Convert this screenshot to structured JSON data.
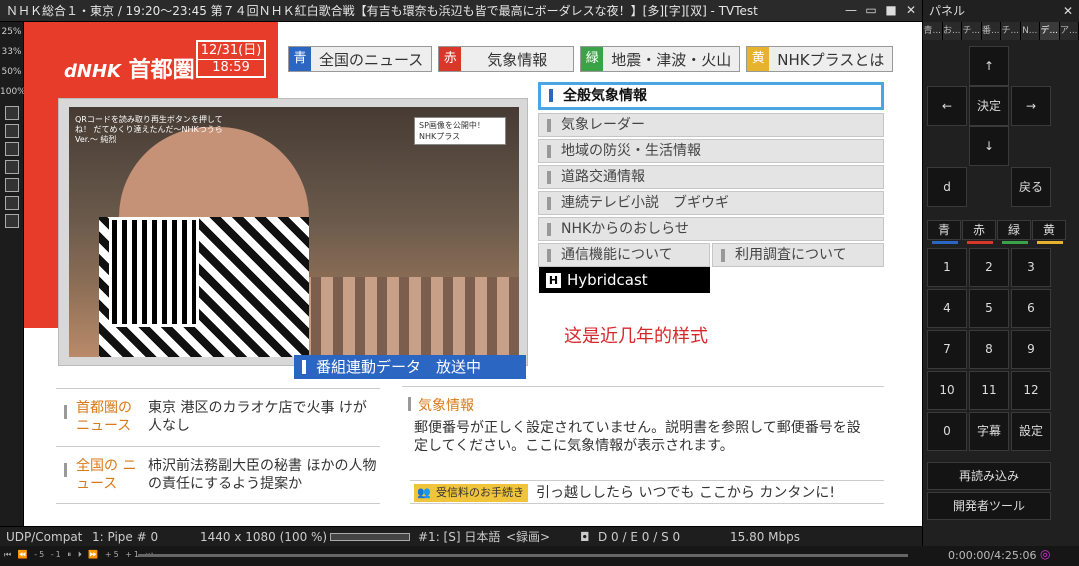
{
  "window": {
    "title": "ＮＨＫ総合１・東京 / 19:20～23:45 第７４回ＮＨＫ紅白歌合戦【有吉も環奈も浜辺も皆で最高にボーダレスな夜！】[多][字][双] - TVTest",
    "minimize": "—",
    "restore": "▭",
    "maximize": "■",
    "close": "✕"
  },
  "left_toolbar": {
    "zoom": [
      "25%",
      "33%",
      "50%",
      "100%"
    ]
  },
  "broadcast": {
    "logo_prefix": "dNHK",
    "logo_region": "首都圏",
    "date": "12/31(日)",
    "time": "18:59",
    "tabs": [
      {
        "key": "青",
        "label": "全国のニュース",
        "color": "#2b66c3"
      },
      {
        "key": "赤",
        "label": "気象情報",
        "color": "#d8382a"
      },
      {
        "key": "緑",
        "label": "地震・津波・火山",
        "color": "#3ba347"
      },
      {
        "key": "黄",
        "label": "NHKプラスとは",
        "color": "#e7b32f"
      }
    ],
    "video_caption": "QRコードを読み取り再生ボタンを押してね！ だてめくり達えたんだ～NHKつうらVer.～ 純烈",
    "video_sp_badge": "SP画像を公開中！ NHKプラス",
    "onair_label": "番組連動データ　放送中",
    "menu_items": [
      "全般気象情報",
      "気象レーダー",
      "地域の防災・生活情報",
      "道路交通情報",
      "連続テレビ小説　ブギウギ",
      "NHKからのおしらせ"
    ],
    "menu_row": [
      "通信機能について",
      "利用調査について"
    ],
    "hybridcast_icon": "H",
    "hybridcast_label": "Hybridcast",
    "annotation": "这是近几年的样式",
    "news": [
      {
        "heading": "首都圏の ニュース",
        "body": "東京 港区のカラオケ店で火事 けが人なし"
      },
      {
        "heading": "全国の ニュース",
        "body": "柿沢前法務副大臣の秘書 ほかの人物の責任にするよう提案か"
      }
    ],
    "weather_heading": "気象情報",
    "weather_body": "郵便番号が正しく設定されていません。説明書を参照して郵便番号を設定してください。ここに気象情報が表示されます。",
    "fee_tag": "受信料のお手続き",
    "fee_text": "引っ越ししたら いつでも ここから カンタンに!"
  },
  "status_bar": {
    "transport": "UDP/Compat",
    "pipe": "1: Pipe # 0",
    "resolution": "1440 x 1080 (100 %)",
    "audio": "#1: [S] 日本語",
    "record": "<録画>",
    "errors": "D 0 / E 0 / S 0",
    "bitrate": "15.80 Mbps"
  },
  "seek_bar": {
    "controls": "⏮ ⏪ -5 -1 ⏸ ⏵ ⏩ +5 +1 ⏭",
    "time": "0:00:00/4:25:06",
    "watermark": "◎"
  },
  "panel": {
    "title": "パネル",
    "close": "✕",
    "tabs": [
      "青...",
      "お...",
      "チ...",
      "番...",
      "チ...",
      "N...",
      "デ...",
      "ア..."
    ],
    "active_tab": 6,
    "up": "↑",
    "left": "←",
    "enter": "決定",
    "right": "→",
    "down": "↓",
    "d": "d",
    "back": "戻る",
    "color_keys": [
      {
        "label": "青",
        "color": "#2b66c3"
      },
      {
        "label": "赤",
        "color": "#d8382a"
      },
      {
        "label": "緑",
        "color": "#3ba347"
      },
      {
        "label": "黄",
        "color": "#e7b32f"
      }
    ],
    "numpad": [
      "1",
      "2",
      "3",
      "4",
      "5",
      "6",
      "7",
      "8",
      "9",
      "10",
      "11",
      "12",
      "0",
      "字幕",
      "設定"
    ],
    "reload": "再読み込み",
    "devtools": "開発者ツール"
  }
}
